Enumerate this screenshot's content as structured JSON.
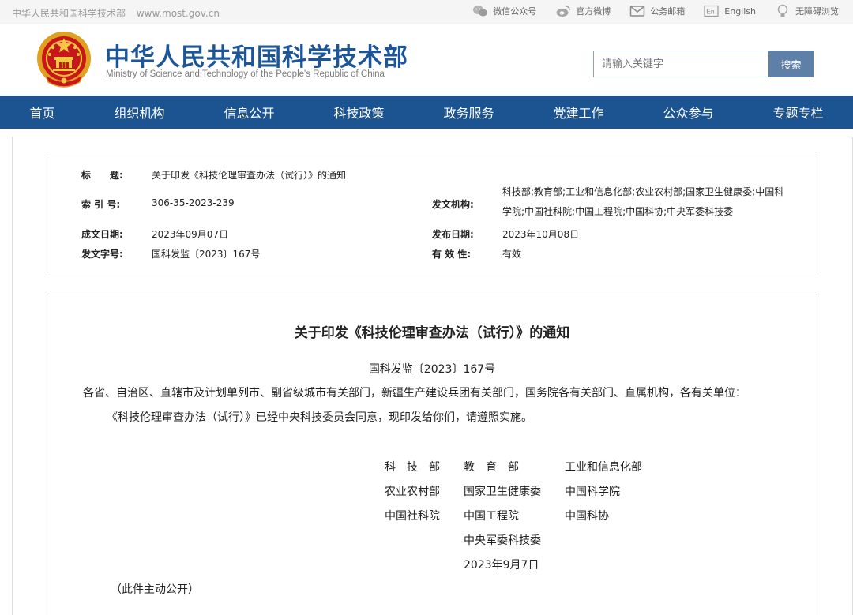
{
  "topbar": {
    "site_name": "中华人民共和国科学技术部",
    "site_url": "www.most.gov.cn",
    "links": [
      {
        "label": "微信公众号",
        "icon": "wechat-icon"
      },
      {
        "label": "官方微博",
        "icon": "weibo-icon"
      },
      {
        "label": "公务邮箱",
        "icon": "mail-icon"
      },
      {
        "label": "English",
        "icon": "english-icon"
      },
      {
        "label": "无障碍浏览",
        "icon": "accessibility-icon"
      }
    ]
  },
  "header": {
    "title_cn": "中华人民共和国科学技术部",
    "title_en": "Ministry of Science and Technology of the People's Republic of China",
    "search_placeholder": "请输入关键字",
    "search_button": "搜索"
  },
  "nav": {
    "items": [
      "首页",
      "组织机构",
      "信息公开",
      "科技政策",
      "政务服务",
      "党建工作",
      "公众参与",
      "专题专栏"
    ]
  },
  "meta": {
    "title_label": "标　　题:",
    "title_value": "关于印发《科技伦理审查办法（试行）》的通知",
    "index_label": "索 引 号:",
    "index_value": "306-35-2023-239",
    "issuer_label": "发文机构:",
    "issuer_value": "科技部;教育部;工业和信息化部;农业农村部;国家卫生健康委;中国科学院;中国社科院;中国工程院;中国科协;中央军委科技委",
    "created_label": "成文日期:",
    "created_value": "2023年09月07日",
    "published_label": "发布日期:",
    "published_value": "2023年10月08日",
    "docno_label": "发文字号:",
    "docno_value": "国科发监〔2023〕167号",
    "validity_label": "有 效 性:",
    "validity_value": "有效"
  },
  "document": {
    "title": "关于印发《科技伦理审查办法（试行）》的通知",
    "number": "国科发监〔2023〕167号",
    "addressee": "各省、自治区、直辖市及计划单列市、副省级城市有关部门，新疆生产建设兵团有关部门，国务院各有关部门、直属机构，各有关单位：",
    "body": "《科技伦理审查办法（试行）》已经中央科技委员会同意，现印发给你们，请遵照实施。",
    "signatories": [
      [
        "科　技　部",
        "教　育　部",
        "工业和信息化部"
      ],
      [
        "农业农村部",
        "国家卫生健康委",
        "中国科学院"
      ],
      [
        "中国社科院",
        "中国工程院",
        "中国科协"
      ],
      [
        "",
        "中央军委科技委",
        ""
      ]
    ],
    "date": "2023年9月7日",
    "footnote": "（此件主动公开）"
  },
  "colors": {
    "brand_blue": "#1c5491",
    "title_blue": "#1c5698",
    "search_button": "#5e80a8"
  }
}
